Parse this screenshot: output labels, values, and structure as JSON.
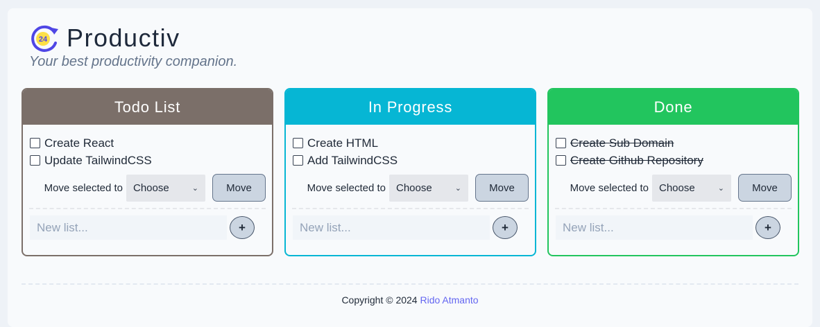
{
  "app": {
    "title": "Productiv",
    "subtitle": "Your best productivity companion.",
    "logo_text": "24"
  },
  "columns": [
    {
      "title": "Todo List",
      "color": "#7b6f69",
      "items": [
        {
          "label": "Create React",
          "done": false
        },
        {
          "label": "Update TailwindCSS",
          "done": false
        }
      ],
      "move_label": "Move selected to",
      "select_value": "Choose",
      "move_button": "Move",
      "new_placeholder": "New list...",
      "add_button": "+"
    },
    {
      "title": "In Progress",
      "color": "#06b6d4",
      "items": [
        {
          "label": "Create HTML",
          "done": false
        },
        {
          "label": "Add TailwindCSS",
          "done": false
        }
      ],
      "move_label": "Move selected to",
      "select_value": "Choose",
      "move_button": "Move",
      "new_placeholder": "New list...",
      "add_button": "+"
    },
    {
      "title": "Done",
      "color": "#22c55e",
      "items": [
        {
          "label": "Create Sub Domain",
          "done": true
        },
        {
          "label": "Create Github Repository",
          "done": true
        }
      ],
      "move_label": "Move selected to",
      "select_value": "Choose",
      "move_button": "Move",
      "new_placeholder": "New list...",
      "add_button": "+"
    }
  ],
  "footer": {
    "copyright": "Copyright © 2024",
    "author": "Rido Atmanto",
    "link_color": "#6366f1"
  }
}
